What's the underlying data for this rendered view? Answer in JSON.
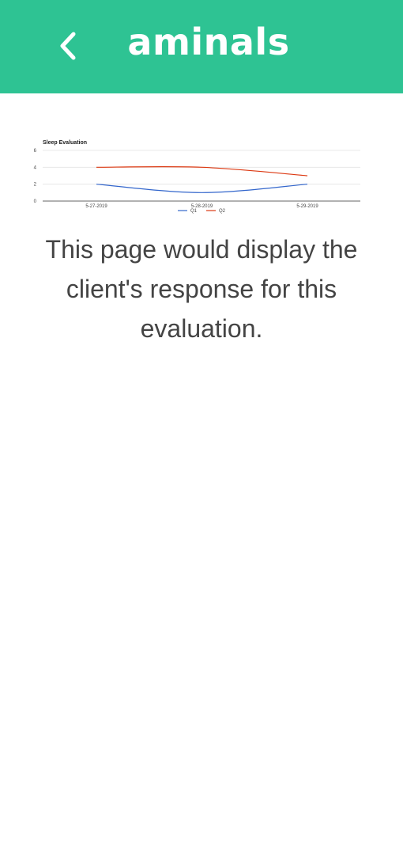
{
  "header": {
    "title": "aminals",
    "back_icon": "chevron-left-icon",
    "background_color": "#2ec393"
  },
  "main": {
    "message": "This page would display the client's response for this evaluation."
  },
  "chart_data": {
    "type": "line",
    "title": "Sleep Evaluation",
    "categories": [
      "5-27-2019",
      "5-28-2019",
      "5-29-2019"
    ],
    "series": [
      {
        "name": "Q1",
        "color": "#3366cc",
        "values": [
          2,
          1,
          2
        ]
      },
      {
        "name": "Q2",
        "color": "#dc3912",
        "values": [
          4,
          4,
          3
        ]
      }
    ],
    "yticks": [
      0,
      2,
      4,
      6
    ],
    "ylim": [
      0,
      6
    ],
    "xlabel": "",
    "ylabel": "",
    "grid": true,
    "legend": "bottom",
    "curve": "smooth"
  }
}
